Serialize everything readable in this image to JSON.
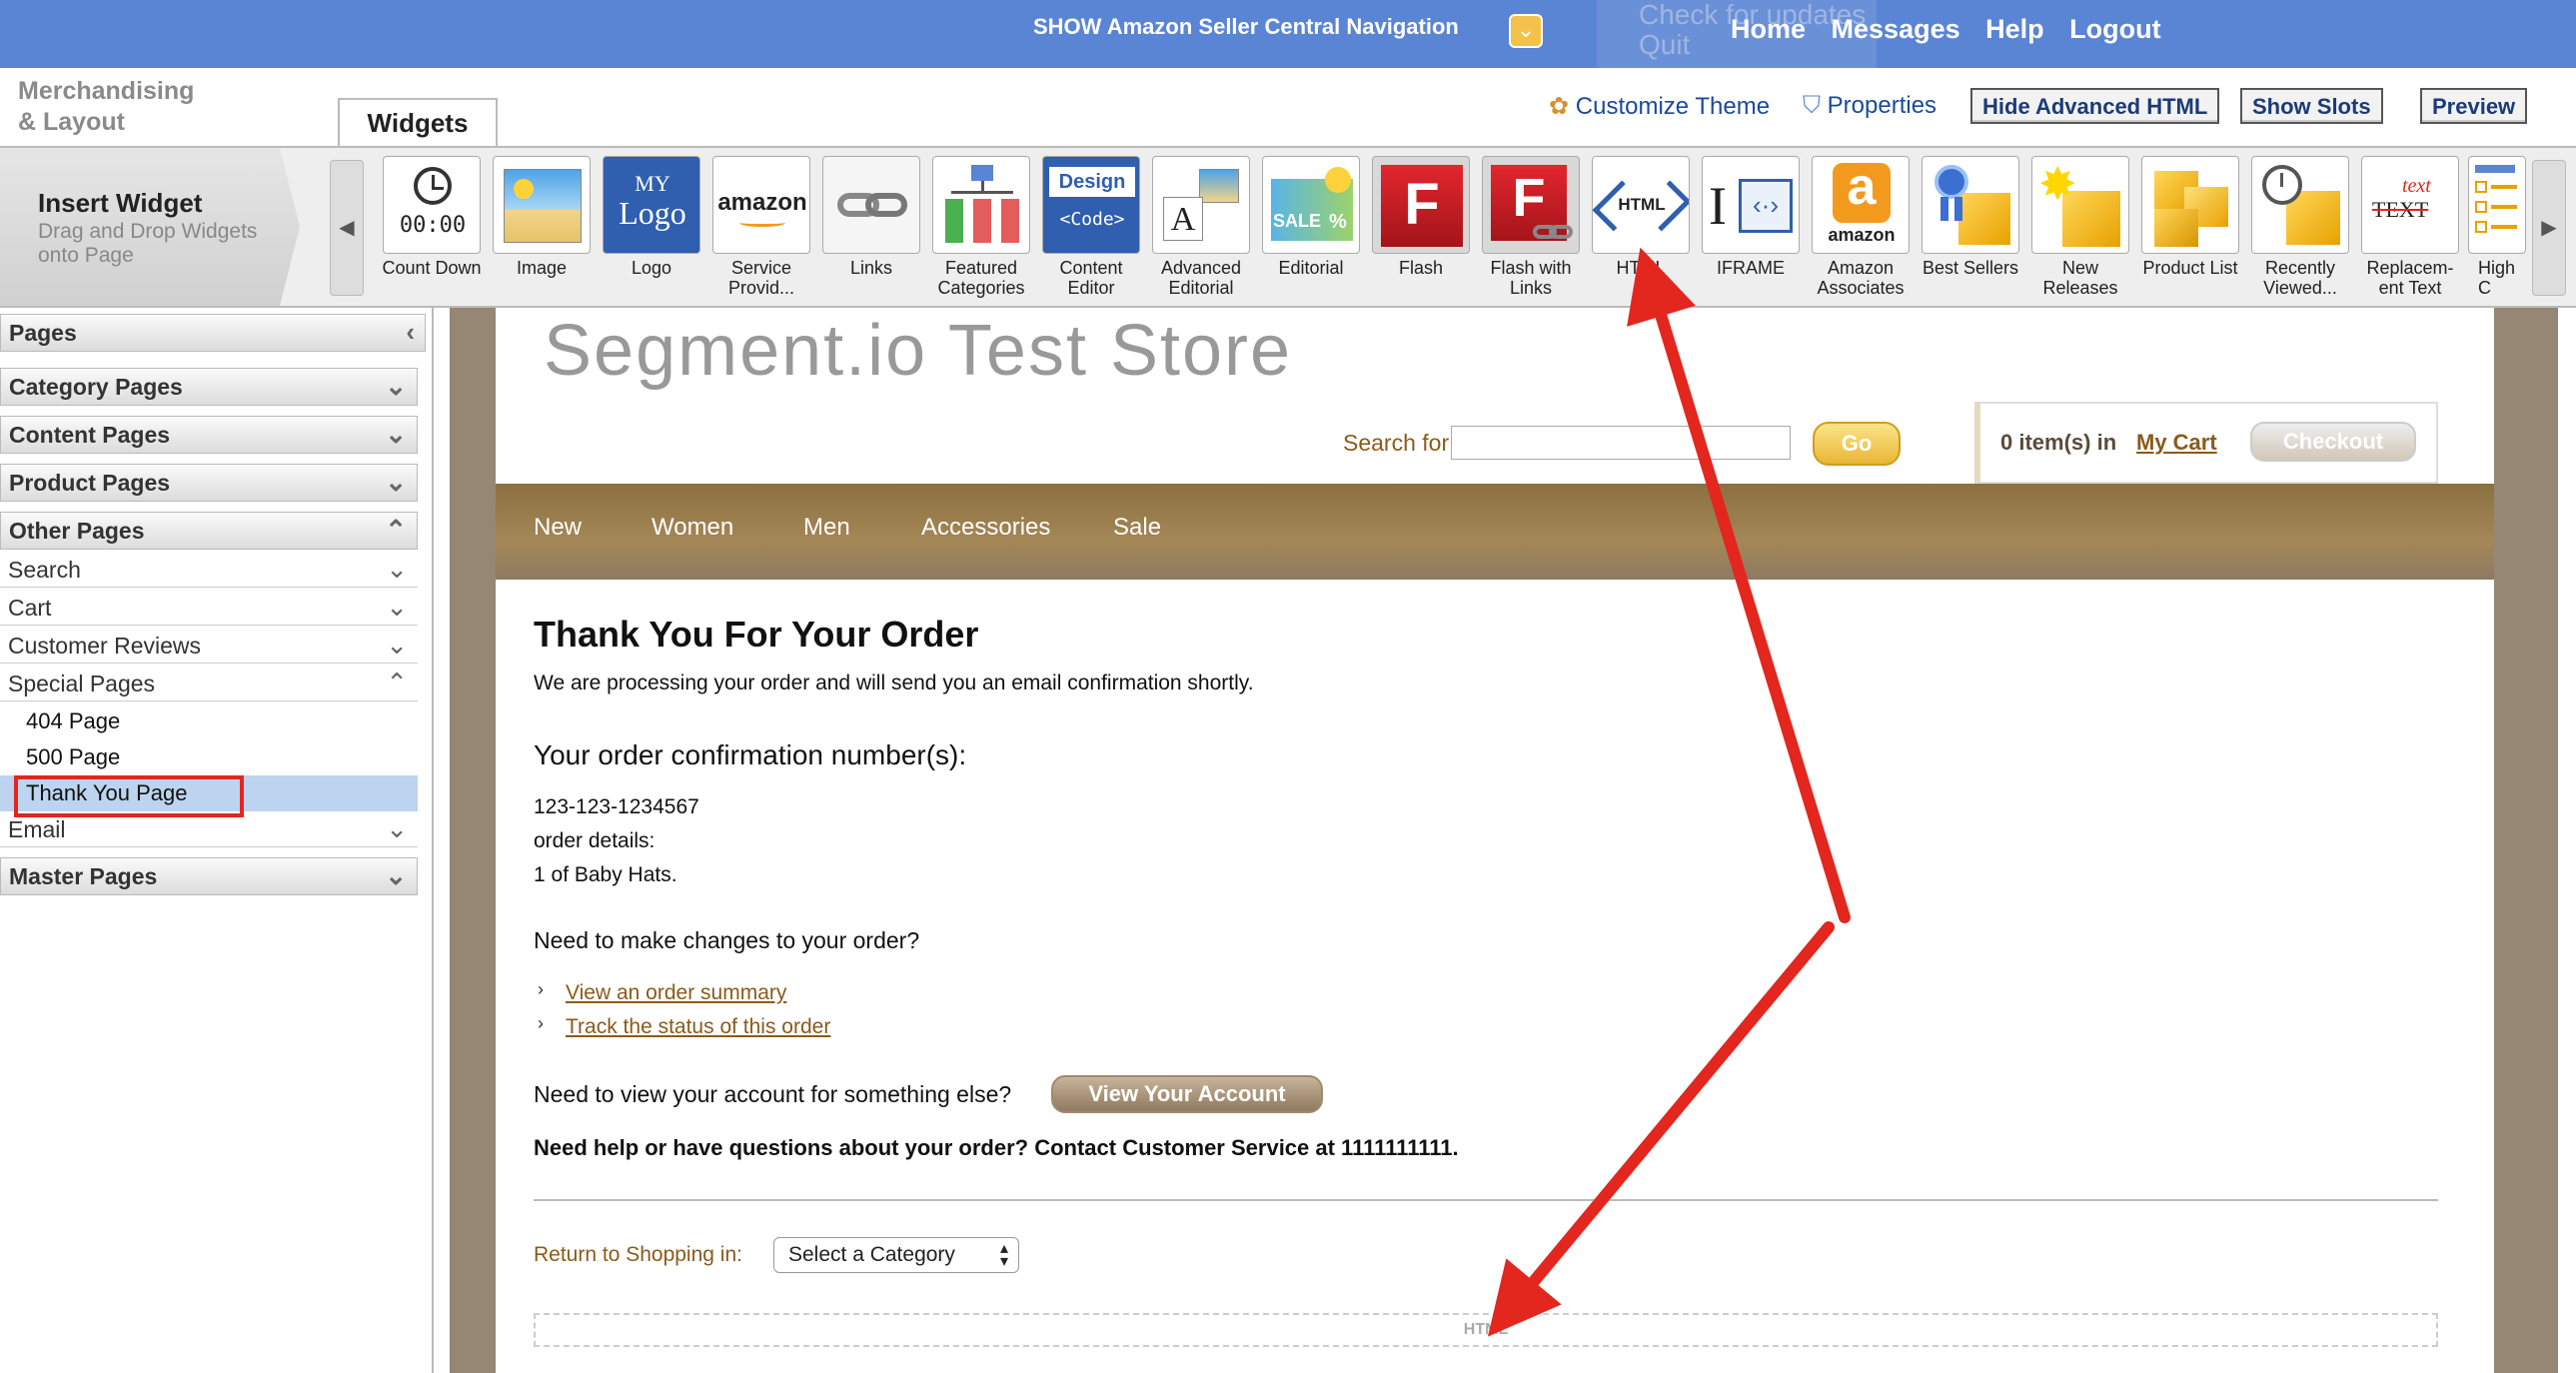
{
  "topbar": {
    "show_nav": "SHOW Amazon Seller Central Navigation",
    "update_line1": "Check for updates",
    "update_line2": "Quit",
    "links": [
      "Home",
      "Messages",
      "Help",
      "Logout"
    ]
  },
  "brand": {
    "line1": "Merchandising",
    "line2": "& Layout"
  },
  "tabs": {
    "widgets": "Widgets"
  },
  "toolbar": {
    "customize_theme": "Customize Theme",
    "properties": "Properties",
    "hide_advanced_html": "Hide Advanced HTML",
    "show_slots": "Show Slots",
    "preview": "Preview"
  },
  "insert_widget": {
    "title": "Insert Widget",
    "subtitle": "Drag and Drop Widgets onto Page"
  },
  "widgets": [
    {
      "label": "Count Down",
      "icon": "clock-icon"
    },
    {
      "label": "Image",
      "icon": "image-icon"
    },
    {
      "label": "Logo",
      "icon": "logo-icon"
    },
    {
      "label": "Service Provid...",
      "icon": "amazon-service-icon"
    },
    {
      "label": "Links",
      "icon": "chain-link-icon"
    },
    {
      "label": "Featured Categories",
      "icon": "category-tree-icon"
    },
    {
      "label": "Content Editor",
      "icon": "design-code-icon"
    },
    {
      "label": "Advanced Editorial",
      "icon": "advanced-editorial-icon"
    },
    {
      "label": "Editorial",
      "icon": "sale-editorial-icon"
    },
    {
      "label": "Flash",
      "icon": "flash-icon"
    },
    {
      "label": "Flash with Links",
      "icon": "flash-links-icon"
    },
    {
      "label": "HTML",
      "icon": "html-icon"
    },
    {
      "label": "IFRAME",
      "icon": "iframe-icon"
    },
    {
      "label": "Amazon Associates",
      "icon": "amazon-associates-icon"
    },
    {
      "label": "Best Sellers",
      "icon": "ribbon-box-icon"
    },
    {
      "label": "New Releases",
      "icon": "star-box-icon"
    },
    {
      "label": "Product List",
      "icon": "boxes-icon"
    },
    {
      "label": "Recently Viewed...",
      "icon": "clock-box-icon"
    },
    {
      "label": "Replacem- ent Text",
      "icon": "replace-text-icon"
    },
    {
      "label": "High C",
      "icon": "list-icon"
    }
  ],
  "widget_icon_text": {
    "countdown": "00:00",
    "logo_top": "MY",
    "logo_bottom": "Logo",
    "amazon": "amazon",
    "design": "Design",
    "code": "<Code>",
    "editorial_letter": "A",
    "sale": "SALE",
    "flash": "F",
    "html": "HTML",
    "iframe": "I",
    "associates_letter": "a",
    "replace_text_top": "text",
    "replace_text_bottom": "TEXT"
  },
  "sidebar": {
    "pages": "Pages",
    "category_pages": "Category Pages",
    "content_pages": "Content Pages",
    "product_pages": "Product Pages",
    "other_pages": "Other Pages",
    "search": "Search",
    "cart": "Cart",
    "customer_reviews": "Customer Reviews",
    "special_pages": "Special Pages",
    "page_404": "404 Page",
    "page_500": "500 Page",
    "thank_you_page": "Thank You Page",
    "email": "Email",
    "master_pages": "Master Pages"
  },
  "store": {
    "title": "Segment.io Test Store",
    "search_for": "Search for",
    "search_value": "",
    "go": "Go",
    "cart_items": "0 item(s) in",
    "my_cart": "My Cart",
    "checkout": "Checkout",
    "nav": [
      "New",
      "Women",
      "Men",
      "Accessories",
      "Sale"
    ]
  },
  "order": {
    "title": "Thank You For Your Order",
    "description": "We are processing your order and will send you an email confirmation shortly.",
    "confirmation_heading": "Your order confirmation number(s):",
    "confirmation_number": "123-123-1234567",
    "details_label": "order details:",
    "item": "1 of Baby Hats.",
    "changes_question": "Need to make changes to your order?",
    "link_summary": "View an order summary",
    "link_track": "Track the status of this order",
    "account_question": "Need to view your account for something else?",
    "account_button": "View Your Account",
    "help_text": "Need help or have questions about your order? Contact Customer Service at 1111111111.",
    "return_label": "Return to Shopping in:",
    "category_select": "Select a Category",
    "slot_label": "HTML"
  },
  "colors": {
    "topbar": "#5a84d4",
    "annotation_red": "#e3261e",
    "store_brown": "#968674",
    "link_brown": "#8b5a1a"
  }
}
